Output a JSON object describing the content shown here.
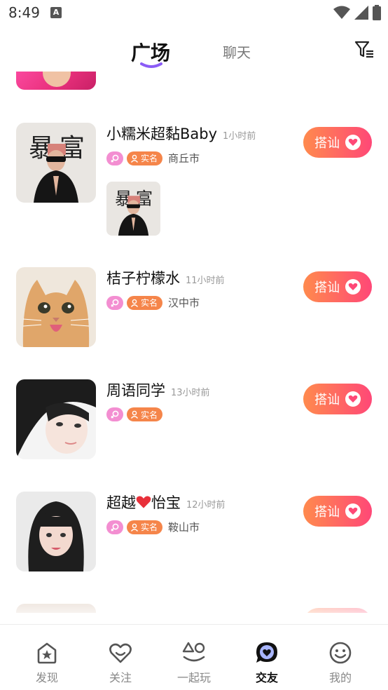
{
  "status_bar": {
    "time": "8:49",
    "notif_letter": "A"
  },
  "header": {
    "tabs": [
      {
        "label": "广场",
        "active": true
      },
      {
        "label": "聊天",
        "active": false
      }
    ],
    "filter_icon": "filter-icon"
  },
  "posts": [
    {
      "name": "小糯米超黏Baby",
      "time": "1小时前",
      "gender": "female",
      "real_tag": "实名",
      "city": "商丘市",
      "chat_label": "搭讪",
      "has_photo": true
    },
    {
      "name": "桔子柠檬水",
      "time": "11小时前",
      "gender": "female",
      "real_tag": "实名",
      "city": "汉中市",
      "chat_label": "搭讪",
      "has_photo": false
    },
    {
      "name": "周语同学",
      "time": "13小时前",
      "gender": "female",
      "real_tag": "实名",
      "city": "",
      "chat_label": "搭讪",
      "has_photo": false
    },
    {
      "name": "超越",
      "name_suffix": "怡宝",
      "time": "12小时前",
      "gender": "female",
      "real_tag": "实名",
      "city": "鞍山市",
      "chat_label": "搭讪",
      "has_photo": false
    }
  ],
  "bottom_nav": [
    {
      "label": "发现",
      "icon": "home-star-icon",
      "active": false
    },
    {
      "label": "关注",
      "icon": "heart-smile-icon",
      "active": false
    },
    {
      "label": "一起玩",
      "icon": "shapes-icon",
      "active": false
    },
    {
      "label": "交友",
      "icon": "chat-heart-icon",
      "active": true
    },
    {
      "label": "我的",
      "icon": "smiley-icon",
      "active": false
    }
  ],
  "colors": {
    "accent_orange": "#ff8a4d",
    "accent_pink": "#ff4877",
    "gender_pink": "#f38ed1",
    "real_orange": "#f5854a",
    "tab_underline": "#8b5cf6"
  }
}
